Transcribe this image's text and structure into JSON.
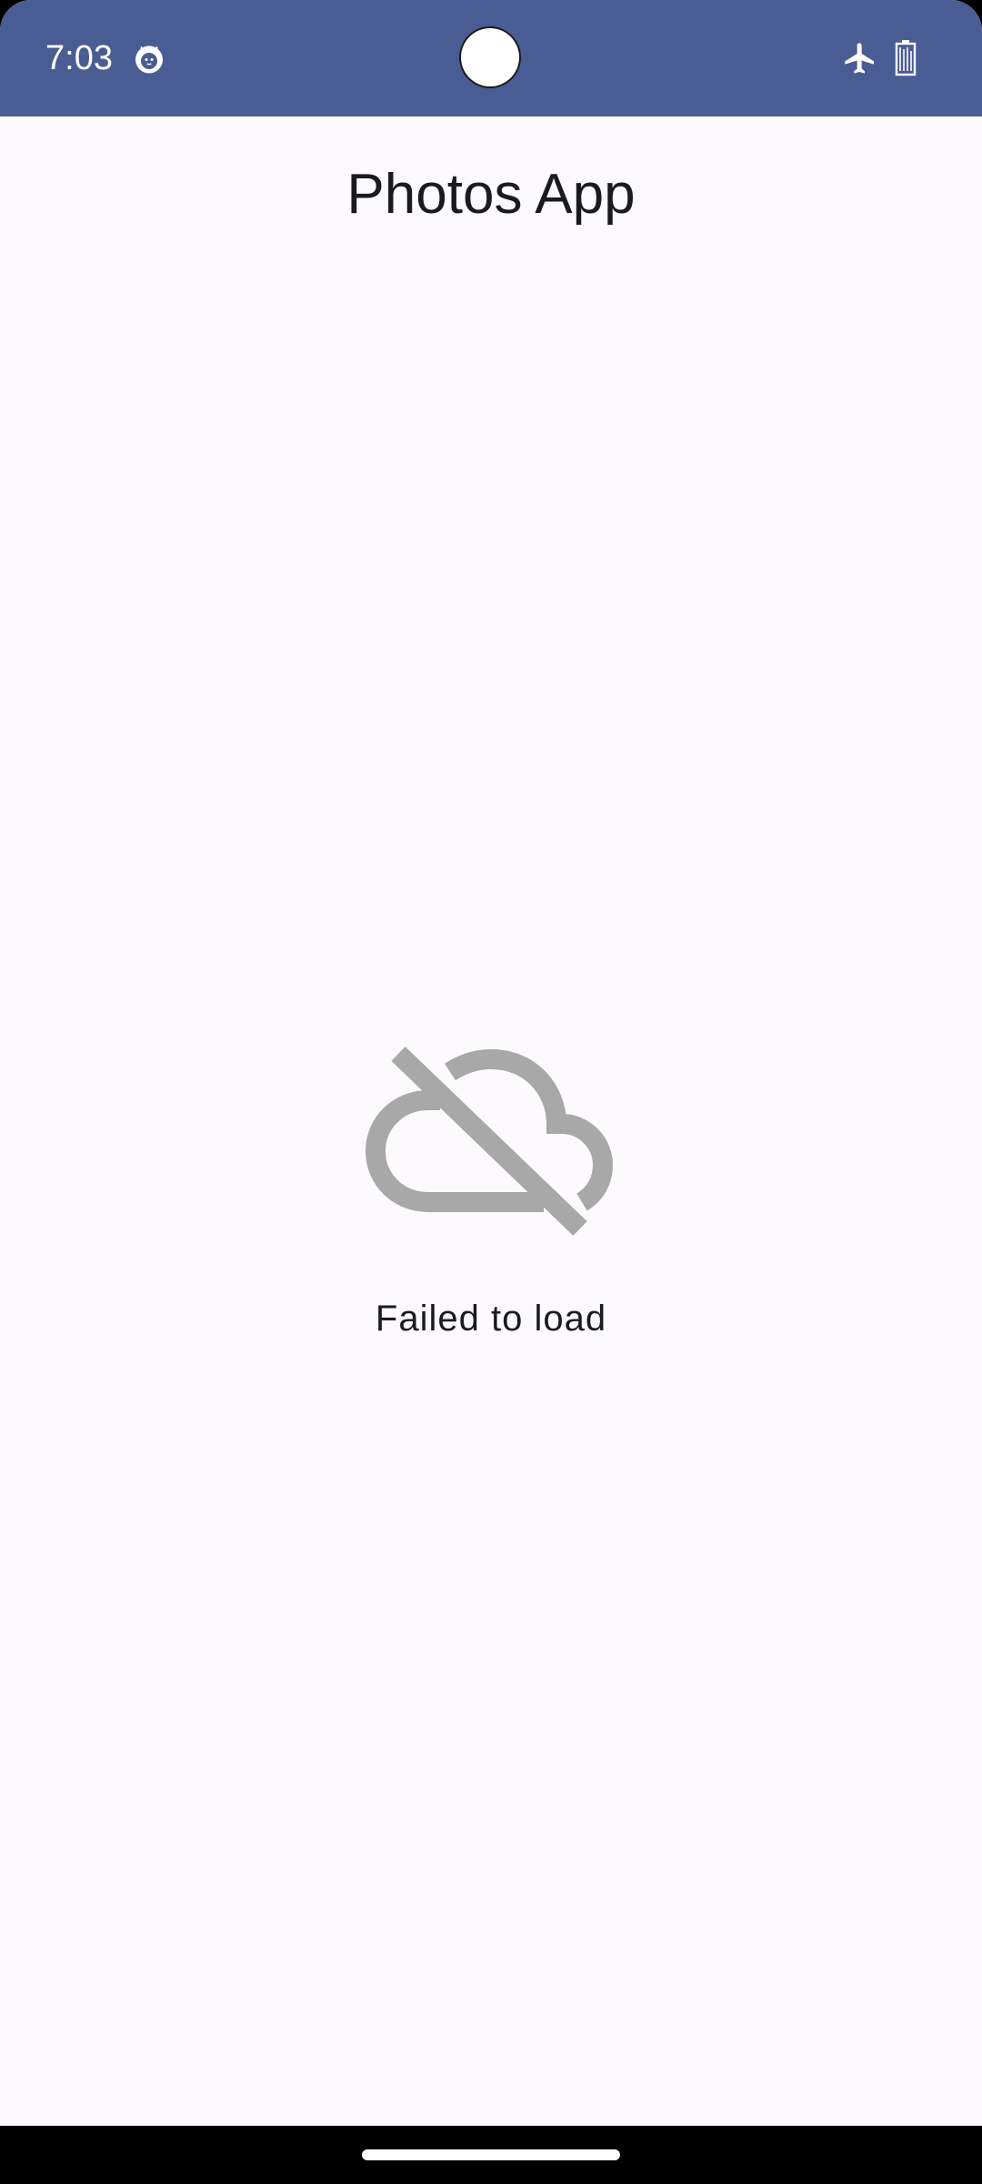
{
  "status_bar": {
    "time": "7:03",
    "app_notification_icon": "cat-face-icon",
    "airplane_icon": "airplane-mode-icon",
    "battery_icon": "battery-icon",
    "background_color": "#4a5c94"
  },
  "header": {
    "title": "Photos App"
  },
  "main": {
    "error_icon": "cloud-off-icon",
    "error_message": "Failed to load",
    "icon_color": "#a8a8a8"
  },
  "colors": {
    "page_background": "#fcfafd",
    "text_primary": "#1b1b1f"
  }
}
